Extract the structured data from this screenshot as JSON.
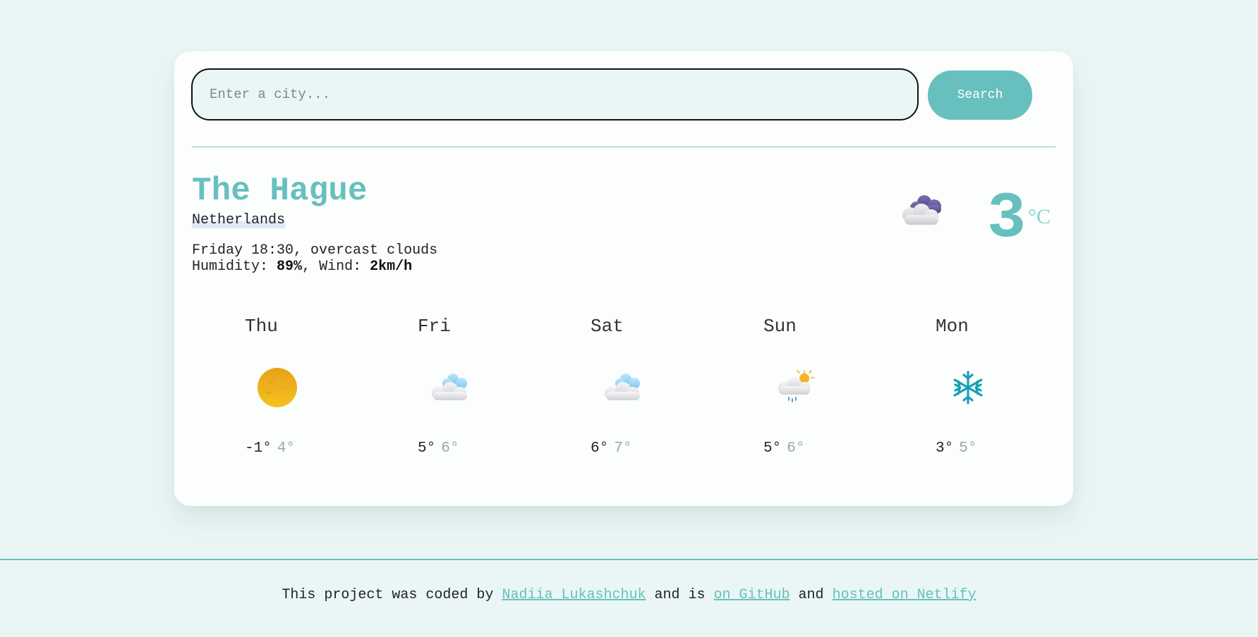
{
  "search": {
    "placeholder": "Enter a city...",
    "value": "",
    "button_label": "Search"
  },
  "current": {
    "city": "The Hague",
    "country": "Netherlands",
    "day_time": "Friday 18:30",
    "description": "overcast clouds",
    "humidity_label": "Humidity:",
    "humidity_value": "89%",
    "wind_label": "Wind:",
    "wind_value": "2km/h",
    "temperature": "3",
    "unit": "°C",
    "icon": "overcast-clouds-icon"
  },
  "forecast": [
    {
      "day": "Thu",
      "icon": "sun-icon",
      "max": "-1°",
      "min": "4°"
    },
    {
      "day": "Fri",
      "icon": "cloud-icon",
      "max": "5°",
      "min": "6°"
    },
    {
      "day": "Sat",
      "icon": "cloud-icon",
      "max": "6°",
      "min": "7°"
    },
    {
      "day": "Sun",
      "icon": "rain-sun-icon",
      "max": "5°",
      "min": "6°"
    },
    {
      "day": "Mon",
      "icon": "snowflake-icon",
      "max": "3°",
      "min": "5°"
    }
  ],
  "footer": {
    "text_1": "This project was coded by ",
    "author_link": "Nadiia Lukashchuk",
    "text_2": " and is ",
    "github_link": "on GitHub",
    "text_3": " and ",
    "netlify_link": "hosted on Netlify"
  },
  "colors": {
    "background": "#e9f6f5",
    "accent": "#67c0be",
    "card": "#fbfefd"
  }
}
